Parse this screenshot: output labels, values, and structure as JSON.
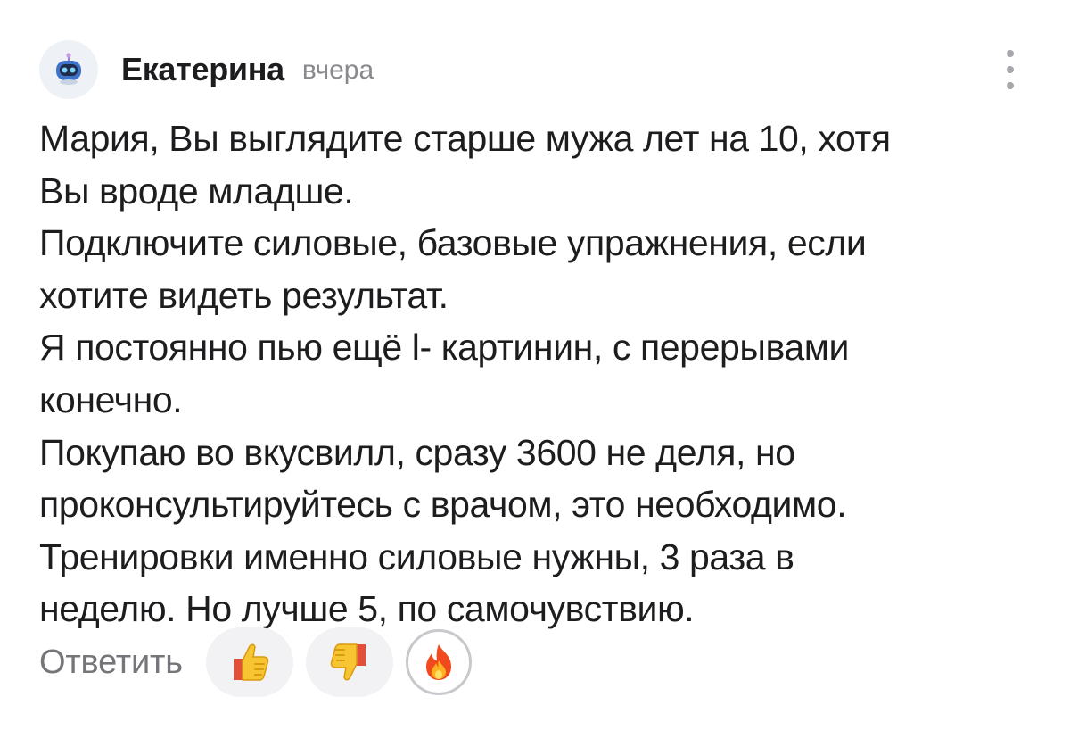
{
  "comment": {
    "author": "Екатерина",
    "time": "вчера",
    "avatar_icon": "robot-icon",
    "lines": [
      "Мария, Вы выглядите старше мужа лет на 10, хотя",
      "Вы вроде младше.",
      "Подключите силовые, базовые упражнения, если",
      "хотите видеть результат.",
      "Я постоянно пью ещё l- картинин, с перерывами",
      "конечно.",
      "Покупаю во вкусвилл, сразу 3600 не деля, но",
      "проконсультируйтесь с врачом, это необходимо.",
      "Тренировки именно силовые нужны, 3 раза в",
      "неделю. Но лучше 5, по самочувствию."
    ]
  },
  "actions": {
    "reply_label": "Ответить",
    "reactions": [
      {
        "icon": "thumbs-up-icon"
      },
      {
        "icon": "thumbs-down-icon"
      },
      {
        "icon": "fire-icon"
      }
    ],
    "more_icon": "more-vertical-icon"
  },
  "colors": {
    "text": "#1d1d1f",
    "secondary": "#8a8a8e",
    "reaction_bg": "#f2f2f4"
  }
}
